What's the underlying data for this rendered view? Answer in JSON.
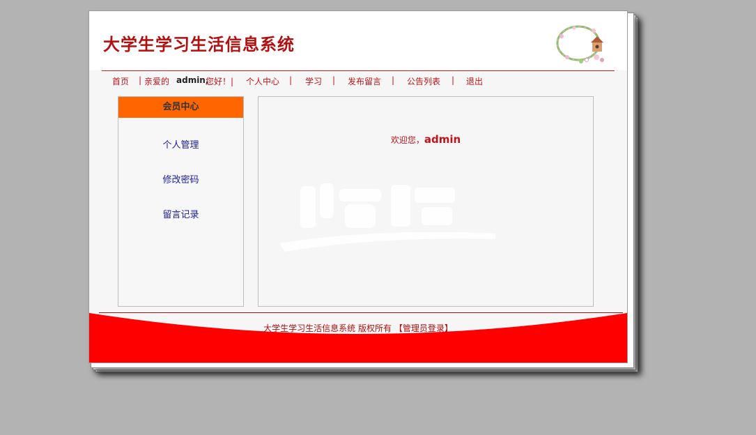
{
  "header": {
    "site_title": "大学生学习生活信息系统"
  },
  "nav": {
    "home": "首页",
    "sep1": "|",
    "greeting_prefix": "亲爱的",
    "username": "admin,",
    "greeting_suffix": "您好！|",
    "personal_center": "个人中心",
    "sep2": "|",
    "study": "学习",
    "sep3": "|",
    "post_message": "发布留言",
    "sep4": "|",
    "announcements": "公告列表",
    "sep5": "|",
    "logout": "退出"
  },
  "sidebar": {
    "title": "会员中心",
    "items": [
      {
        "label": "个人管理"
      },
      {
        "label": "修改密码"
      },
      {
        "label": "留言记录"
      }
    ]
  },
  "main": {
    "welcome_prefix": "欢迎您，",
    "welcome_user": "admin"
  },
  "footer": {
    "copyright": "大学生学习生活信息系统 版权所有",
    "admin_login": "【管理员登录】"
  },
  "colors": {
    "accent_red": "#c0141a",
    "footer_red": "#ff0000",
    "sidebar_header": "#ff6600",
    "link_blue": "#1a1aa0"
  }
}
